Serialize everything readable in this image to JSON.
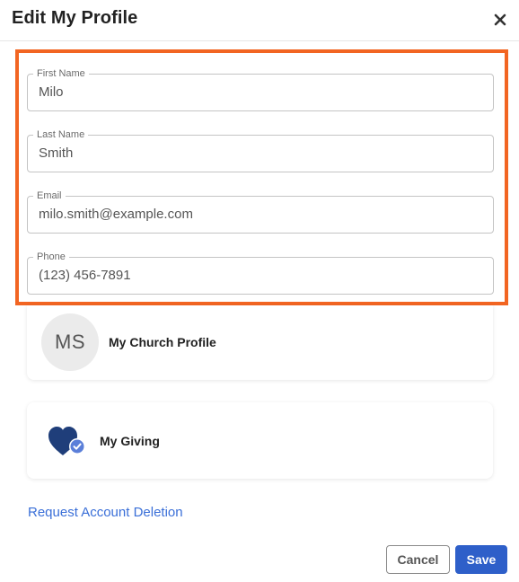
{
  "dialog": {
    "title": "Edit My Profile",
    "close_icon": "close-icon"
  },
  "form": {
    "first_name": {
      "label": "First Name",
      "value": "Milo"
    },
    "last_name": {
      "label": "Last Name",
      "value": "Smith"
    },
    "email": {
      "label": "Email",
      "value": "milo.smith@example.com"
    },
    "phone": {
      "label": "Phone",
      "value": "(123) 456-7891"
    }
  },
  "cards": {
    "church_profile": {
      "initials": "MS",
      "label": "My Church Profile"
    },
    "giving": {
      "icon": "heart-check-icon",
      "label": "My Giving"
    }
  },
  "links": {
    "delete_account": "Request Account Deletion"
  },
  "actions": {
    "cancel": "Cancel",
    "save": "Save"
  },
  "colors": {
    "highlight": "#f26522",
    "primary": "#2e5fc9",
    "link": "#3a6fd8",
    "heart": "#1f3e7a",
    "check_badge": "#5b7fd9"
  }
}
